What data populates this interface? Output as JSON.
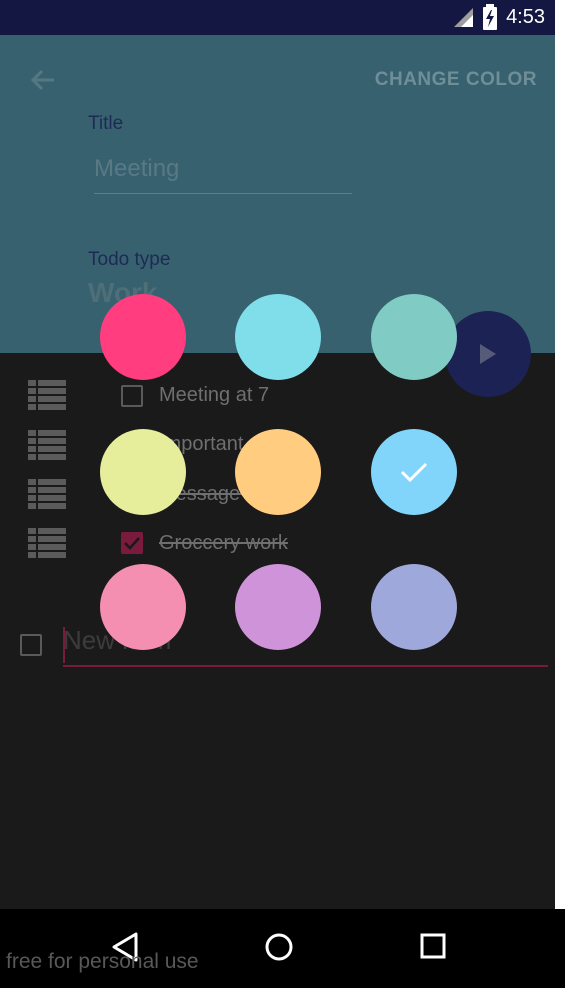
{
  "status_bar": {
    "time": "4:53"
  },
  "toolbar": {
    "change_color_label": "CHANGE COLOR"
  },
  "form": {
    "title_label": "Title",
    "title_value": "Meeting",
    "todo_type_label": "Todo type",
    "todo_type_value": "Work"
  },
  "items": [
    {
      "text": "Meeting at 7",
      "checked": false
    },
    {
      "text": "Important report",
      "checked": false
    },
    {
      "text": "Message receive",
      "checked": false
    },
    {
      "text": "Groccery work",
      "checked": true
    }
  ],
  "new_item": {
    "placeholder": "New item"
  },
  "color_picker": {
    "selected_index": 5,
    "colors": [
      "#ff3d7f",
      "#80deea",
      "#80cbc4",
      "#e6ee9c",
      "#ffcc80",
      "#81d4fa",
      "#f48fb1",
      "#ce93d8",
      "#9fa8da"
    ]
  },
  "accent_colors": {
    "header": "#37616f",
    "fab": "#1c2253",
    "checkbox": "#7a1a3c"
  },
  "watermark": "free for personal use"
}
